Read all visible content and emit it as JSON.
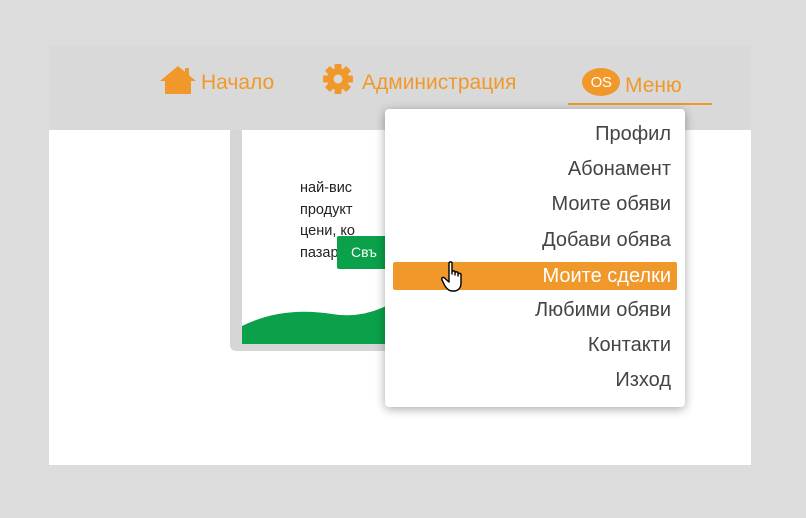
{
  "nav": {
    "home": {
      "label": "Начало",
      "icon": "home-icon"
    },
    "admin": {
      "label": "Администрация",
      "icon": "gear-icon"
    },
    "menu": {
      "label": "Меню",
      "badge": "OS"
    }
  },
  "card": {
    "text": "най-вис\nпродукт\nцени, ко\nпазара.",
    "button_label": "Свъ"
  },
  "dropdown": {
    "items": [
      {
        "label": "Профил"
      },
      {
        "label": "Абонамент"
      },
      {
        "label": "Моите обяви"
      },
      {
        "label": "Добави обява"
      },
      {
        "label": "Моите сделки",
        "active": true
      },
      {
        "label": "Любими обяви"
      },
      {
        "label": "Контакти"
      },
      {
        "label": "Изход"
      }
    ]
  },
  "colors": {
    "accent": "#f0992a",
    "green": "#0aa14a",
    "navbar": "#d9d9d9",
    "frame": "#dcdcdc"
  }
}
